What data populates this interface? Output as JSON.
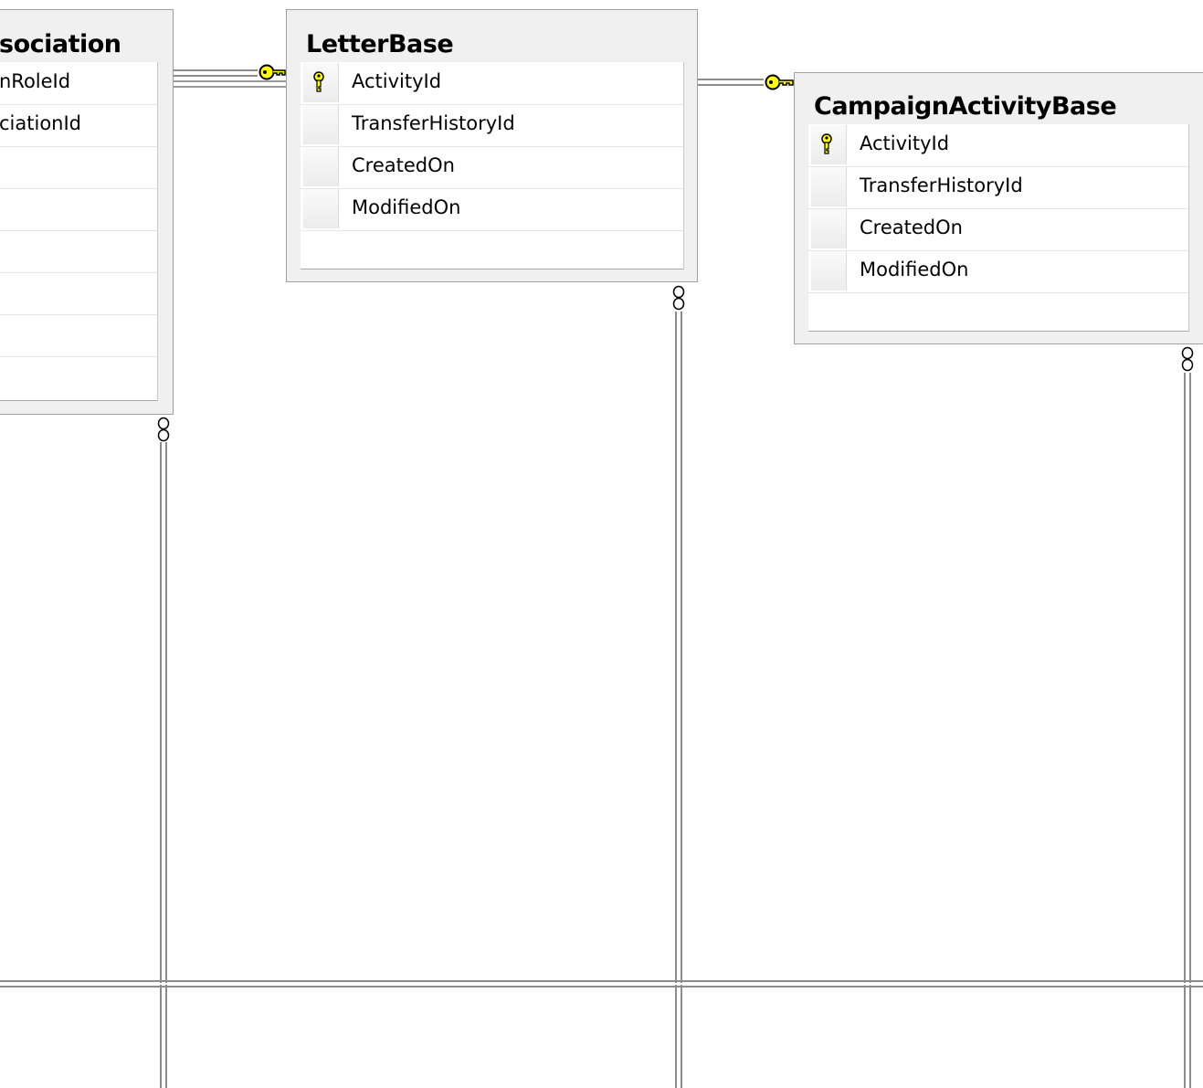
{
  "tables": {
    "association": {
      "title": "sociation",
      "columns": [
        "nRoleId",
        "ciationId",
        "",
        "",
        "",
        "",
        ""
      ]
    },
    "letter_base": {
      "title": "LetterBase",
      "columns": [
        "ActivityId",
        "TransferHistoryId",
        "CreatedOn",
        "ModifiedOn"
      ],
      "primary_key": "ActivityId"
    },
    "campaign_activity_base": {
      "title": "CampaignActivityBase",
      "columns": [
        "ActivityId",
        "TransferHistoryId",
        "CreatedOn",
        "ModifiedOn"
      ],
      "primary_key": "ActivityId"
    }
  },
  "relationships": [
    {
      "from": "association",
      "to": "letter_base",
      "end": "key"
    },
    {
      "from": "letter_base",
      "to": "campaign_activity_base",
      "end": "key"
    },
    {
      "from": "association",
      "end": "infinity"
    },
    {
      "from": "letter_base",
      "end": "infinity"
    },
    {
      "from": "campaign_activity_base",
      "end": "infinity"
    }
  ],
  "icons": {
    "primary_key": "key-icon",
    "one_end": "key-connector-icon",
    "many_end": "infinity-icon"
  },
  "colors": {
    "key_fill": "#ffff00",
    "connector": "#8c8c8c",
    "frame": "#f0f0f0"
  }
}
